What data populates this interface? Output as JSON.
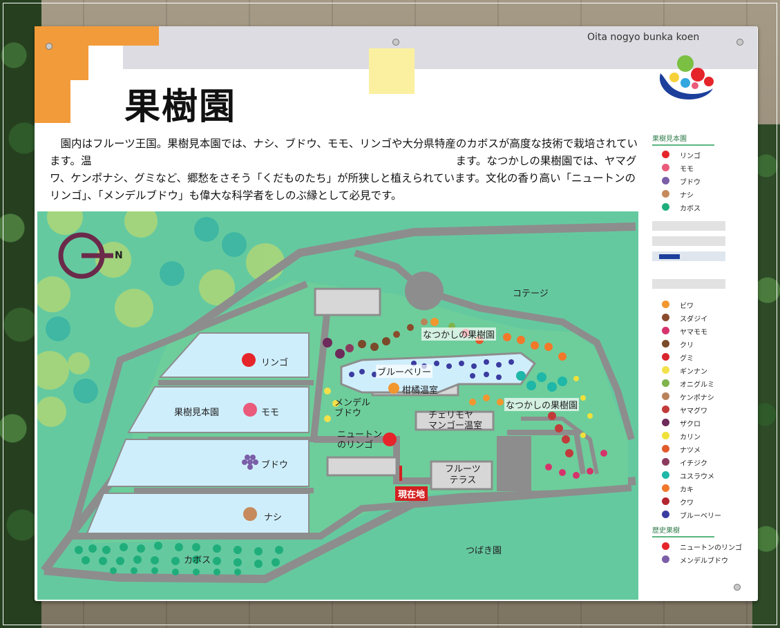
{
  "brand": "Oita nogyo bunka koen",
  "title": "果樹園",
  "intro": "　園内はフルーツ王国。果樹見本園では、ナシ、ブドウ、モモ、リンゴや大分県特産のカボスが高度な技術で栽培されています。温　　　　　　　　　　　　　　　　　　　　　　　　　　　　　　　　　　ます。なつかしの果樹園では、ヤマグワ、ケンポナシ、グミなど、郷愁をさそう「くだものたち」が所狭しと植えられています。文化の香り高い「ニュートンのリンゴ」、「メンデルブドウ」も偉大な科学者をしのぶ縁として必見です。",
  "map": {
    "north_label": "N",
    "labels": {
      "ringo": "リンゴ",
      "mihon": "果樹見本園",
      "momo": "モモ",
      "budou": "ブドウ",
      "nashi": "ナシ",
      "kabosu": "カボス",
      "cottage": "コテージ",
      "natsukashi1": "なつかしの果樹園",
      "natsukashi2": "なつかしの果樹園",
      "blueberry": "ブルーベリー",
      "kankitsu": "柑橘温室",
      "mendel": "メンデル\nブドウ",
      "cherimoya": "チェリモヤ\nマンゴー温室",
      "newton": "ニュートン\nのリンゴ",
      "fruit_terrace": "フルーツ\nテラス",
      "tsubaki": "つばき園",
      "here": "現在地"
    }
  },
  "legend": {
    "head1": "果樹見本園",
    "group1": [
      {
        "label": "リンゴ",
        "color": "#e5252a"
      },
      {
        "label": "モモ",
        "color": "#ea5a7a"
      },
      {
        "label": "ブドウ",
        "color": "#7b5ea8"
      },
      {
        "label": "ナシ",
        "color": "#c68a5c"
      },
      {
        "label": "カボス",
        "color": "#1fae7b"
      }
    ],
    "group2": [
      {
        "label": "ビワ",
        "color": "#f2962f"
      },
      {
        "label": "スダジイ",
        "color": "#8a4b2d"
      },
      {
        "label": "ヤマモモ",
        "color": "#d6336c"
      },
      {
        "label": "クリ",
        "color": "#7a4a2a"
      },
      {
        "label": "グミ",
        "color": "#d9262e"
      },
      {
        "label": "ギンナン",
        "color": "#f3e04b"
      },
      {
        "label": "オニグルミ",
        "color": "#7fb34b"
      },
      {
        "label": "ケンポナシ",
        "color": "#b9835a"
      },
      {
        "label": "ヤマグワ",
        "color": "#c23b3b"
      },
      {
        "label": "ザクロ",
        "color": "#6e2a5a"
      },
      {
        "label": "カリン",
        "color": "#f0e13a"
      },
      {
        "label": "ナツメ",
        "color": "#e25a2a"
      },
      {
        "label": "イチジク",
        "color": "#8b3a5e"
      },
      {
        "label": "ユスラウメ",
        "color": "#1eb7a8"
      },
      {
        "label": "カキ",
        "color": "#f2782a"
      },
      {
        "label": "クワ",
        "color": "#b3262e"
      },
      {
        "label": "ブルーベリー",
        "color": "#3b3ca0"
      }
    ],
    "head2": "歴史果樹",
    "group3": [
      {
        "label": "ニュートンのリンゴ",
        "color": "#e5252a"
      },
      {
        "label": "メンデルブドウ",
        "color": "#7b5ea8"
      }
    ]
  }
}
